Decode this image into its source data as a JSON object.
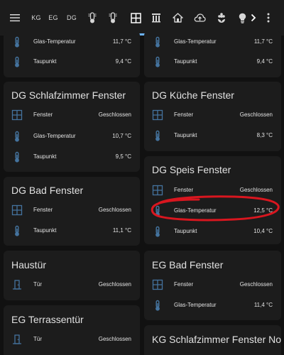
{
  "colors": {
    "accent": "#6cb2f5",
    "icon": "#44739e",
    "card": "#1c1c1c",
    "background": "#111111",
    "annotation": "#d9161f"
  },
  "topbar": {
    "menu_icon": "hamburger-icon",
    "tabs": [
      {
        "label": "KG"
      },
      {
        "label": "EG"
      },
      {
        "label": "DG"
      }
    ],
    "icons": [
      "thermometer-icon",
      "thermometer-icon",
      "window-icon",
      "radiator-icon",
      "home-icon",
      "cloud-upload-icon",
      "flower-icon",
      "lightbulb-icon"
    ],
    "more_icon": "chevron-right-icon",
    "overflow_icon": "dots-vertical-icon"
  },
  "cards": {
    "top_left": {
      "rows": [
        {
          "name": "Glas-Temperatur",
          "value": "11,7 °C",
          "icon": "thermometer-icon"
        },
        {
          "name": "Taupunkt",
          "value": "9,4 °C",
          "icon": "thermometer-icon"
        }
      ]
    },
    "top_right": {
      "rows": [
        {
          "name": "Glas-Temperatur",
          "value": "11,7 °C",
          "icon": "thermometer-icon"
        },
        {
          "name": "Taupunkt",
          "value": "9,4 °C",
          "icon": "thermometer-icon"
        }
      ]
    },
    "dg_schlafzimmer": {
      "title": "DG Schlafzimmer Fenster",
      "rows": [
        {
          "name": "Fenster",
          "value": "Geschlossen",
          "icon": "window-icon"
        },
        {
          "name": "Glas-Temperatur",
          "value": "10,7 °C",
          "icon": "thermometer-icon"
        },
        {
          "name": "Taupunkt",
          "value": "9,5 °C",
          "icon": "thermometer-icon"
        }
      ]
    },
    "dg_kueche": {
      "title": "DG Küche Fenster",
      "rows": [
        {
          "name": "Fenster",
          "value": "Geschlossen",
          "icon": "window-icon"
        },
        {
          "name": "Taupunkt",
          "value": "8,3 °C",
          "icon": "thermometer-icon"
        }
      ]
    },
    "dg_speis": {
      "title": "DG Speis Fenster",
      "rows": [
        {
          "name": "Fenster",
          "value": "Geschlossen",
          "icon": "window-icon"
        },
        {
          "name": "Glas-Temperatur",
          "value": "12,5 °C",
          "icon": "thermometer-icon"
        },
        {
          "name": "Taupunkt",
          "value": "10,4 °C",
          "icon": "thermometer-icon"
        }
      ]
    },
    "dg_bad": {
      "title": "DG Bad Fenster",
      "rows": [
        {
          "name": "Fenster",
          "value": "Geschlossen",
          "icon": "window-icon"
        },
        {
          "name": "Taupunkt",
          "value": "11,1 °C",
          "icon": "thermometer-icon"
        }
      ]
    },
    "haustuer": {
      "title": "Haustür",
      "rows": [
        {
          "name": "Tür",
          "value": "Geschlossen",
          "icon": "door-icon"
        }
      ]
    },
    "eg_bad": {
      "title": "EG Bad Fenster",
      "rows": [
        {
          "name": "Fenster",
          "value": "Geschlossen",
          "icon": "window-icon"
        },
        {
          "name": "Glas-Temperatur",
          "value": "11,4 °C",
          "icon": "thermometer-icon"
        }
      ]
    },
    "eg_terrasse": {
      "title": "EG Terrassentür",
      "rows": [
        {
          "name": "Tür",
          "value": "Geschlossen",
          "icon": "door-icon"
        }
      ]
    },
    "kg_schlafzimmer": {
      "title": "KG Schlafzimmer Fenster Nord"
    }
  }
}
